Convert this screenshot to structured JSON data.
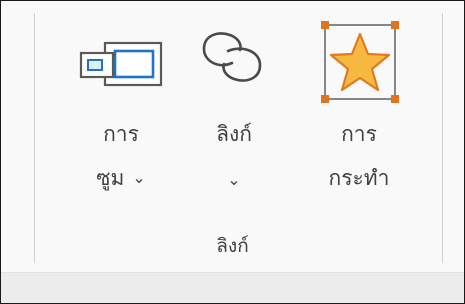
{
  "ribbon": {
    "group_label": "ลิงก์",
    "commands": {
      "zoom": {
        "icon": "zoom-icon",
        "line1": "การ",
        "line2": "ซูม",
        "chevron": "⌄"
      },
      "link": {
        "icon": "link-icon",
        "line1": "ลิงก์",
        "chevron": "⌄"
      },
      "action": {
        "icon": "star-action-icon",
        "line1": "การ",
        "line2": "กระทำ"
      }
    }
  },
  "colors": {
    "accent_blue": "#1f74c8",
    "star_fill": "#f7b841",
    "star_stroke": "#e07a1f",
    "handle_orange": "#e2731b"
  }
}
